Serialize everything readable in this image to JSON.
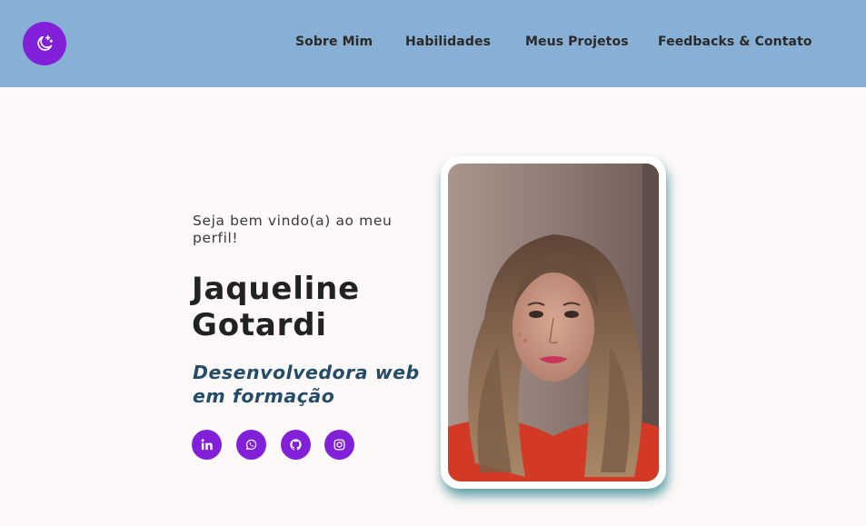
{
  "header": {
    "logo_icon": "moon-stars-icon",
    "nav": [
      "Sobre Mim",
      "Habilidades",
      "Meus Projetos",
      "Feedbacks & Contato"
    ]
  },
  "hero": {
    "greeting": "Seja bem vindo(a) ao meu perfil!",
    "name": "Jaqueline Gotardi",
    "role": "Desenvolvedora web em formação",
    "social_icons": [
      "linkedin-icon",
      "whatsapp-icon",
      "github-icon",
      "instagram-icon"
    ]
  },
  "colors": {
    "header_bg": "#88b0d4",
    "accent": "#8120d8",
    "role_text": "#264d68",
    "page_bg": "#fdf9f8"
  }
}
